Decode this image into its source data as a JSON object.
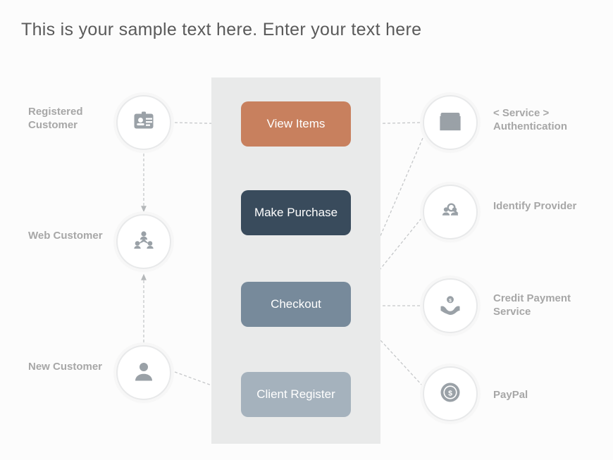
{
  "title": "This is your sample text here. Enter your text here",
  "left_nodes": {
    "n1": {
      "label": "Registered Customer",
      "icon": "id-badge-icon"
    },
    "n2": {
      "label": "Web Customer",
      "icon": "org-group-icon"
    },
    "n3": {
      "label": "New Customer",
      "icon": "user-icon"
    }
  },
  "right_nodes": {
    "n1": {
      "label": "< Service > Authentication",
      "icon": "code-window-icon"
    },
    "n2": {
      "label": "Identify Provider",
      "icon": "inspect-group-icon"
    },
    "n3": {
      "label": "Credit Payment Service",
      "icon": "hands-coin-icon"
    },
    "n4": {
      "label": "PayPal",
      "icon": "currency-coin-icon"
    }
  },
  "actions": {
    "a1": "View Items",
    "a2": "Make Purchase",
    "a3": "Checkout",
    "a4": "Client Register"
  },
  "dashed_arrows": [
    {
      "from": "left.n1",
      "to": "action.a1"
    },
    {
      "from": "left.n1",
      "to": "left.n2"
    },
    {
      "from": "left.n3",
      "to": "left.n2"
    },
    {
      "from": "left.n3",
      "to": "action.a4"
    },
    {
      "from": "right.n1",
      "to": "action.a1"
    },
    {
      "from": "right.n1",
      "to": "action.a3"
    },
    {
      "from": "right.n2",
      "to": "action.a3"
    },
    {
      "from": "right.n3",
      "to": "action.a3"
    },
    {
      "from": "right.n4",
      "to": "action.a3"
    }
  ],
  "colors": {
    "action1": "#c8805e",
    "action2": "#394b5c",
    "action3": "#778a9b",
    "action4": "#a5b2bd",
    "panel": "#e9eaea",
    "icon": "#9aa1a7",
    "label": "#a7a7a7"
  }
}
